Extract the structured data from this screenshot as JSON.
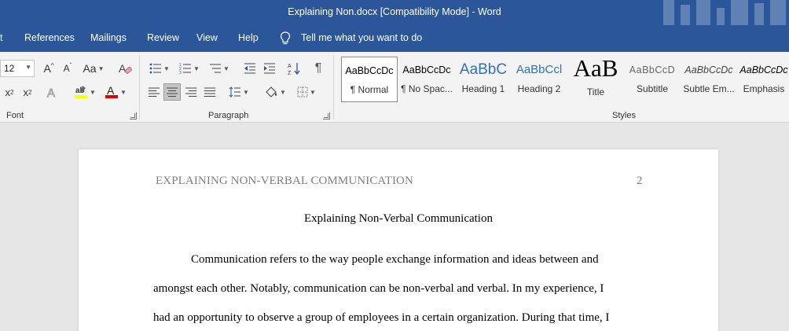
{
  "window": {
    "title": "Explaining Non.docx [Compatibility Mode]  -  Word"
  },
  "menu": {
    "tabs": [
      {
        "label": "t"
      },
      {
        "label": "References"
      },
      {
        "label": "Mailings"
      },
      {
        "label": "Review"
      },
      {
        "label": "View"
      },
      {
        "label": "Help"
      }
    ],
    "tell_me": "Tell me what you want to do"
  },
  "ribbon": {
    "font_size": "12",
    "groups": {
      "font": "Font",
      "paragraph": "Paragraph",
      "styles": "Styles"
    },
    "grow_label": "A",
    "shrink_label": "A",
    "case_label": "Aa",
    "subscript_label": "x",
    "superscript_label": "x",
    "sub_digit": "2",
    "sup_digit": "2",
    "highlight_color": "#ffff00",
    "font_color": "#ff0000",
    "styles": [
      {
        "sample": "AaBbCcDc",
        "name": "¶ Normal"
      },
      {
        "sample": "AaBbCcDc",
        "name": "¶ No Spac..."
      },
      {
        "sample": "AaBbC",
        "name": "Heading 1"
      },
      {
        "sample": "AaBbCcl",
        "name": "Heading 2"
      },
      {
        "sample": "AaB",
        "name": "Title"
      },
      {
        "sample": "AaBbCcD",
        "name": "Subtitle"
      },
      {
        "sample": "AaBbCcDc",
        "name": "Subtle Em..."
      },
      {
        "sample": "AaBbCcDc",
        "name": "Emphasis"
      }
    ]
  },
  "document": {
    "header": "EXPLAINING NON-VERBAL COMMUNICATION",
    "page_number": "2",
    "title": "Explaining Non-Verbal Communication",
    "lines": [
      "Communication refers to the way people exchange information and ideas between and",
      "amongst each other. Notably, communication can be non-verbal and verbal. In my experience, I",
      "had an opportunity to observe a group of employees in a certain organization. During that time, I"
    ]
  },
  "colors": {
    "title_bar": "#2b579a",
    "ribbon_bg": "#f3f3f3",
    "canvas_bg": "#e6e6e6"
  }
}
